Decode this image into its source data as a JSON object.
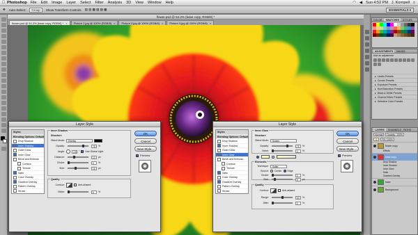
{
  "menubar": {
    "app_name": "Photoshop",
    "items": [
      "File",
      "Edit",
      "Image",
      "Layer",
      "Select",
      "Filter",
      "Analysis",
      "3D",
      "View",
      "Window",
      "Help"
    ],
    "clock": "Sun 4:52 PM",
    "user": "J. Kornpell"
  },
  "optionsbar": {
    "auto_select": "Auto-Select:",
    "auto_select_value": "Group",
    "show_transform": "Show Transform Controls",
    "essentials": "ESSENTIALS ▾"
  },
  "document": {
    "title": "flower.psd @ 54.3% (base copy, RGB/8) *",
    "tabs": [
      {
        "label": "flower.psd @ 54.3% (base copy, RGB/8) *",
        "active": true
      },
      {
        "label": "Picture 1.jpg @ 100% (RGB/8)",
        "active": false
      },
      {
        "label": "Picture 2.jpg @ 100% (RGB/8)",
        "active": false
      },
      {
        "label": "Picture 3.jpg @ 100% (RGB/8)",
        "active": false
      }
    ]
  },
  "panels": {
    "color_tabs": [
      "COLOR",
      "SWATCHES",
      "STYLES"
    ],
    "adjust_tabs": [
      "ADJUSTMENTS",
      "MASKS"
    ],
    "add_adjustment": "Add an adjustment",
    "presets": [
      "Levels Presets",
      "Curves Presets",
      "Exposure Presets",
      "Hue/Saturation Presets",
      "Black & White Presets",
      "Channel Mixer Presets",
      "Selective Color Presets"
    ],
    "layer_tabs": [
      "LAYERS",
      "CHANNELS",
      "PATHS"
    ],
    "blend_mode": "Normal",
    "opacity": "Opacity: 100%",
    "fill": "Fill: 100%",
    "layers": [
      {
        "name": "flower copy",
        "selected": false
      },
      {
        "name": "base copy",
        "selected": true
      },
      {
        "name": "base",
        "selected": false
      },
      {
        "name": "Background",
        "selected": false
      }
    ],
    "effects_labels": [
      "Effects",
      "Drop Shadow",
      "Inner Shadow",
      "Inner Glow",
      "Satin",
      "Gradient Overlay"
    ]
  },
  "dialog_left": {
    "title": "Layer Style",
    "styles_items": [
      {
        "label": "Styles",
        "kind": "hdr"
      },
      {
        "label": "Blending Options: Default",
        "kind": "hdr"
      },
      {
        "label": "Drop Shadow",
        "kind": "cb",
        "checked": false
      },
      {
        "label": "Inner Shadow",
        "kind": "cb",
        "checked": true,
        "selected": true
      },
      {
        "label": "Outer Glow",
        "kind": "cb",
        "checked": false
      },
      {
        "label": "Inner Glow",
        "kind": "cb",
        "checked": true
      },
      {
        "label": "Bevel and Emboss",
        "kind": "cb",
        "checked": false
      },
      {
        "label": "Contour",
        "kind": "sub",
        "checked": false
      },
      {
        "label": "Texture",
        "kind": "sub",
        "checked": false
      },
      {
        "label": "Satin",
        "kind": "cb",
        "checked": true
      },
      {
        "label": "Color Overlay",
        "kind": "cb",
        "checked": false
      },
      {
        "label": "Gradient Overlay",
        "kind": "cb",
        "checked": true
      },
      {
        "label": "Pattern Overlay",
        "kind": "cb",
        "checked": false
      },
      {
        "label": "Stroke",
        "kind": "cb",
        "checked": false
      }
    ],
    "section": "Inner Shadow",
    "structure": "Structure",
    "blend_mode_label": "Blend Mode:",
    "blend_mode": "Overlay",
    "opacity_label": "Opacity:",
    "opacity": "75",
    "angle_label": "Angle:",
    "angle": "120",
    "global_light": "Use Global Light",
    "distance_label": "Distance:",
    "distance": "13",
    "choke_label": "Choke:",
    "choke": "0",
    "size_label": "Size:",
    "size": "16",
    "quality": "Quality",
    "contour_label": "Contour:",
    "anti_aliased": "Anti-aliased",
    "noise_label": "Noise:",
    "noise": "0",
    "unit_pct": "%",
    "unit_px": "px",
    "ok": "OK",
    "cancel": "Cancel",
    "new_style": "New Style...",
    "preview": "Preview"
  },
  "dialog_right": {
    "title": "Layer Style",
    "styles_items": [
      {
        "label": "Styles",
        "kind": "hdr"
      },
      {
        "label": "Blending Options: Default",
        "kind": "hdr"
      },
      {
        "label": "Drop Shadow",
        "kind": "cb",
        "checked": false
      },
      {
        "label": "Inner Shadow",
        "kind": "cb",
        "checked": true
      },
      {
        "label": "Outer Glow",
        "kind": "cb",
        "checked": false
      },
      {
        "label": "Inner Glow",
        "kind": "cb",
        "checked": true,
        "selected": true
      },
      {
        "label": "Bevel and Emboss",
        "kind": "cb",
        "checked": false
      },
      {
        "label": "Contour",
        "kind": "sub",
        "checked": false
      },
      {
        "label": "Texture",
        "kind": "sub",
        "checked": false
      },
      {
        "label": "Satin",
        "kind": "cb",
        "checked": true
      },
      {
        "label": "Color Overlay",
        "kind": "cb",
        "checked": false
      },
      {
        "label": "Gradient Overlay",
        "kind": "cb",
        "checked": true
      },
      {
        "label": "Pattern Overlay",
        "kind": "cb",
        "checked": false
      },
      {
        "label": "Stroke",
        "kind": "cb",
        "checked": false
      }
    ],
    "section": "Inner Glow",
    "structure": "Structure",
    "blend_mode_label": "Blend Mode:",
    "blend_mode": "Screen",
    "opacity_label": "Opacity:",
    "opacity": "75",
    "noise_label": "Noise:",
    "noise": "0",
    "elements": "Elements",
    "technique_label": "Technique:",
    "technique": "Softer",
    "source_label": "Source:",
    "center": "Center",
    "edge": "Edge",
    "choke_label": "Choke:",
    "choke": "0",
    "size_label": "Size:",
    "size": "5",
    "quality": "Quality",
    "contour_label": "Contour:",
    "anti_aliased": "Anti-aliased",
    "range_label": "Range:",
    "range": "50",
    "jitter_label": "Jitter:",
    "jitter": "0",
    "unit_pct": "%",
    "unit_px": "px",
    "ok": "OK",
    "cancel": "Cancel",
    "new_style": "New Style...",
    "preview": "Preview"
  }
}
